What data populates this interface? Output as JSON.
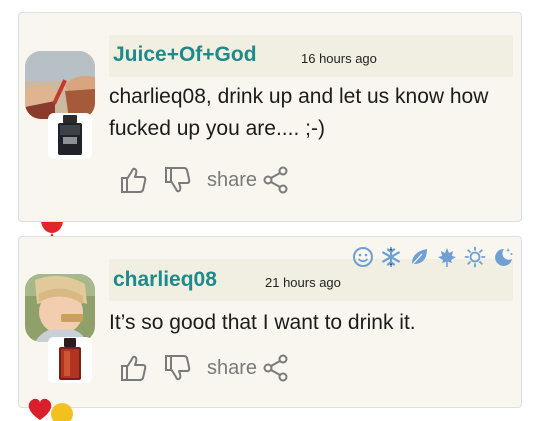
{
  "comments": [
    {
      "username": "Juice+Of+God",
      "timestamp": "16 hours ago",
      "text": "charlieq08, drink up and let us know how fucked up you are.... ;-)",
      "share_label": "share"
    },
    {
      "username": "charlieq08",
      "timestamp": "21 hours ago",
      "text": "It’s so good that I want to drink it.",
      "share_label": "share"
    }
  ],
  "mood_icons": [
    "smile-icon",
    "snowflake-icon",
    "leaf-icon",
    "maple-leaf-icon",
    "sun-icon",
    "moon-stars-icon"
  ],
  "colors": {
    "accent": "#1e8a8a",
    "mood_icon": "#6f9fd3",
    "card_bg": "#f8f6ee",
    "header_band": "#f1efe2",
    "action_icon": "#7a7a7a"
  }
}
